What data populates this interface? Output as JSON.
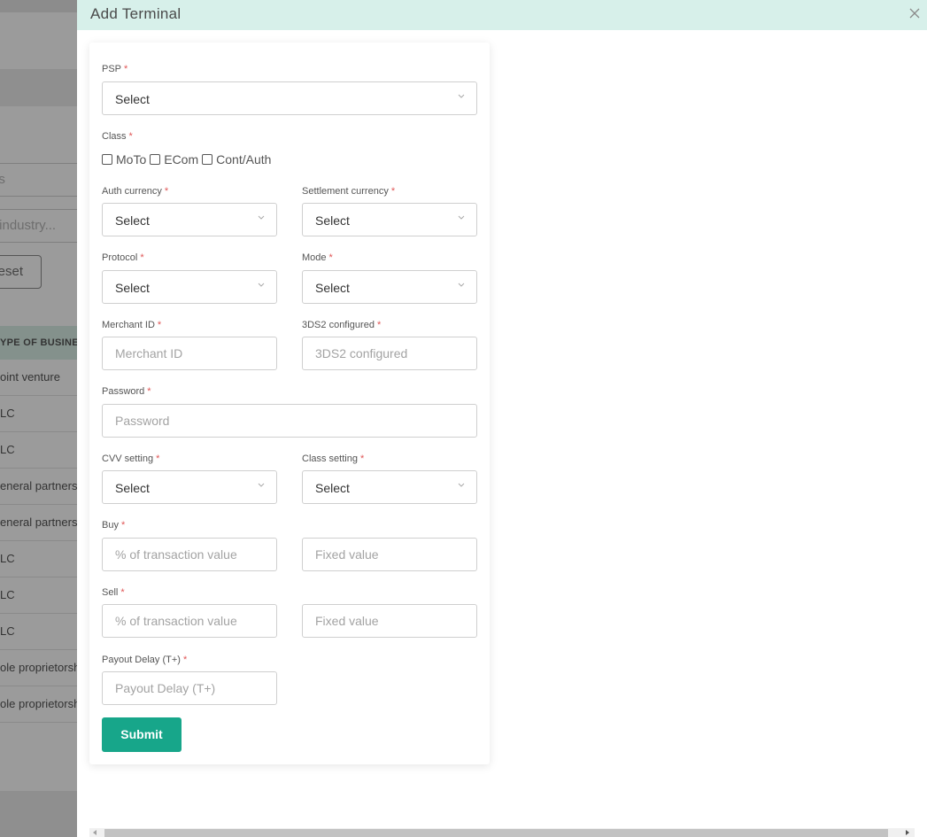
{
  "background": {
    "status_filter": "us",
    "industry_filter": "r industry...",
    "reset_label": "eset",
    "column_header": "YPE OF BUSINES",
    "rows": [
      "oint venture",
      "LC",
      "LC",
      "eneral partners",
      "eneral partners",
      "LC",
      "LC",
      "LC",
      "ole proprietorsh",
      "ole proprietorsh"
    ]
  },
  "drawer": {
    "title": "Add Terminal",
    "close_icon": "close-icon",
    "required_mark": "*"
  },
  "form": {
    "psp": {
      "label": "PSP",
      "value": "Select"
    },
    "class": {
      "label": "Class",
      "options": [
        "MoTo",
        "ECom",
        "Cont/Auth"
      ]
    },
    "auth_currency": {
      "label": "Auth currency",
      "value": "Select"
    },
    "settlement_currency": {
      "label": "Settlement currency",
      "value": "Select"
    },
    "protocol": {
      "label": "Protocol",
      "value": "Select"
    },
    "mode": {
      "label": "Mode",
      "value": "Select"
    },
    "merchant_id": {
      "label": "Merchant ID",
      "placeholder": "Merchant ID"
    },
    "threeds2": {
      "label": "3DS2 configured",
      "placeholder": "3DS2 configured"
    },
    "password": {
      "label": "Password",
      "placeholder": "Password"
    },
    "cvv_setting": {
      "label": "CVV setting",
      "value": "Select"
    },
    "class_setting": {
      "label": "Class setting",
      "value": "Select"
    },
    "buy": {
      "label": "Buy",
      "pct_placeholder": "% of transaction value",
      "fixed_placeholder": "Fixed value"
    },
    "sell": {
      "label": "Sell",
      "pct_placeholder": "% of transaction value",
      "fixed_placeholder": "Fixed value"
    },
    "payout_delay": {
      "label": "Payout Delay (T+)",
      "placeholder": "Payout Delay (T+)"
    },
    "submit_label": "Submit"
  },
  "colors": {
    "accent": "#17a68a",
    "header_bg": "#d7f0ea",
    "required": "#e05555"
  }
}
